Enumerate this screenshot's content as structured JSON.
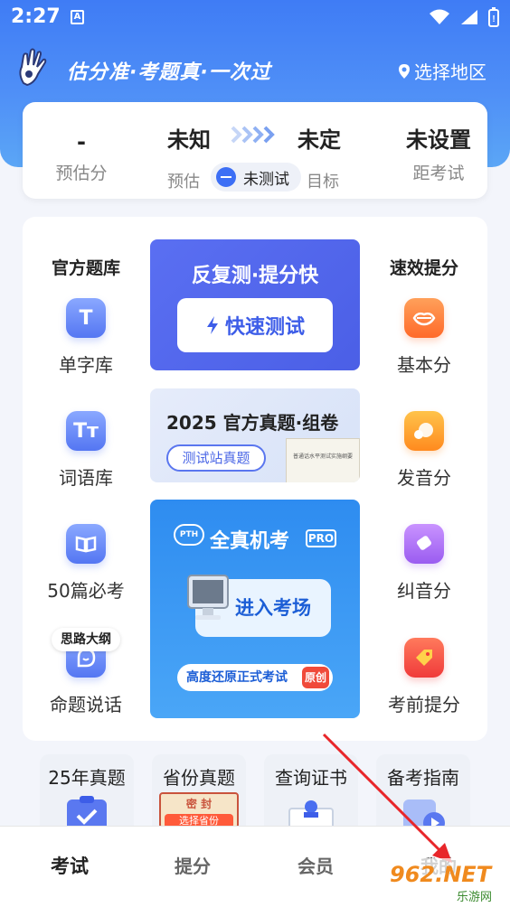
{
  "status": {
    "time": "2:27",
    "badge": "A"
  },
  "header": {
    "slogan": "估分准·考题真·一次过",
    "region": "选择地区"
  },
  "score": {
    "dash": "-",
    "dash_label": "预估分",
    "estimate": "未知",
    "target": "未定",
    "estimate_label": "预估",
    "pill": "未测试",
    "target_label": "目标",
    "unset": "未设置",
    "exam_label": "距考试"
  },
  "left": {
    "title": "官方题库",
    "items": [
      {
        "icon": "T",
        "label": "单字库"
      },
      {
        "icon": "Tт",
        "label": "词语库"
      },
      {
        "icon": "book",
        "label": "50篇必考"
      },
      {
        "icon": "bubble",
        "label": "命题说话",
        "tag": "思路大纲"
      }
    ]
  },
  "right": {
    "title": "速效提分",
    "items": [
      {
        "icon": "lips",
        "label": "基本分"
      },
      {
        "icon": "mic",
        "label": "发音分"
      },
      {
        "icon": "eraser",
        "label": "纠音分"
      },
      {
        "icon": "tag",
        "label": "考前提分"
      }
    ]
  },
  "banner1": {
    "title": "反复测·提分快",
    "button": "快速测试"
  },
  "banner2": {
    "title": "2025 官方真题·组卷",
    "button": "测试站真题",
    "book_title": "普通话水平测试实施纲要"
  },
  "banner3": {
    "logo": "PTH",
    "title": "全真机考",
    "pro": "PRO",
    "button": "进入考场",
    "footer": "高度还原正式考试",
    "badge": "原创"
  },
  "quick": [
    {
      "label": "25年真题"
    },
    {
      "label": "省份真题",
      "sub": "密  封",
      "sub2": "选择省份"
    },
    {
      "label": "查询证书"
    },
    {
      "label": "备考指南"
    }
  ],
  "tabs": [
    {
      "label": "考试",
      "active": true
    },
    {
      "label": "提分"
    },
    {
      "label": "会员"
    },
    {
      "label": "我的"
    }
  ],
  "watermark": {
    "text": "962.NET",
    "sub": "乐游网"
  },
  "colors": {
    "primary": "#3d6ff5",
    "header": "#4f8ff7",
    "accent_red": "#f04a3a"
  }
}
